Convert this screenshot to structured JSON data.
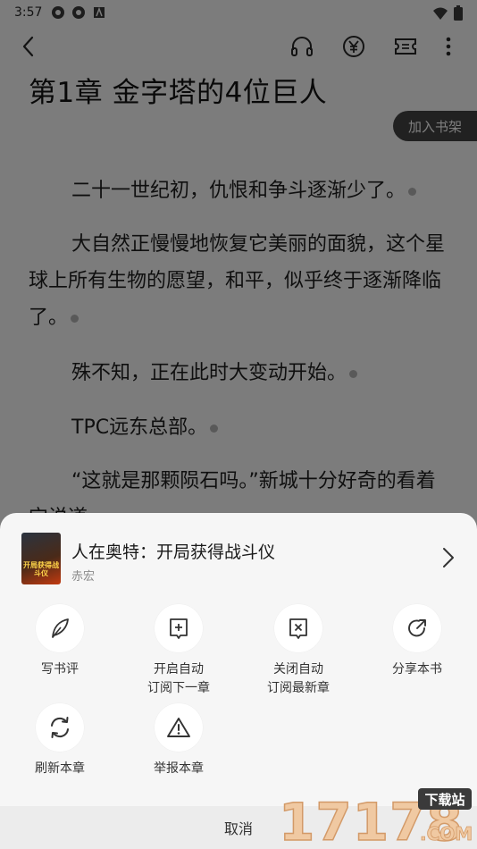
{
  "status_bar": {
    "time": "3:57"
  },
  "reader": {
    "chapter_title": "第1章 金字塔的4位巨人",
    "add_to_shelf": "加入书架",
    "paragraphs": [
      "二十一世纪初，仇恨和争斗逐渐少了。",
      "大自然正慢慢地恢复它美丽的面貌，这个星球上所有生物的愿望，和平，似乎终于逐渐降临了。",
      "殊不知，正在此时大变动开始。",
      "TPC远东总部。",
      "“这就是那颗陨石吗。”新城十分好奇的看着它说道。"
    ]
  },
  "sheet": {
    "book_title": "人在奥特：开局获得战斗仪",
    "book_author": "赤宏",
    "cover_text": "开局获得战斗仪",
    "actions": [
      {
        "label_line1": "写书评",
        "label_line2": "",
        "icon": "quill-icon"
      },
      {
        "label_line1": "开启自动",
        "label_line2": "订阅下一章",
        "icon": "plus-square-icon"
      },
      {
        "label_line1": "关闭自动",
        "label_line2": "订阅最新章",
        "icon": "x-square-icon"
      },
      {
        "label_line1": "分享本书",
        "label_line2": "",
        "icon": "share-arrow-icon"
      },
      {
        "label_line1": "刷新本章",
        "label_line2": "",
        "icon": "refresh-icon"
      },
      {
        "label_line1": "举报本章",
        "label_line2": "",
        "icon": "warning-icon"
      }
    ],
    "cancel": "取消"
  },
  "watermark": {
    "number": "17178",
    "badge": "下载站",
    "suffix": ".COM"
  }
}
